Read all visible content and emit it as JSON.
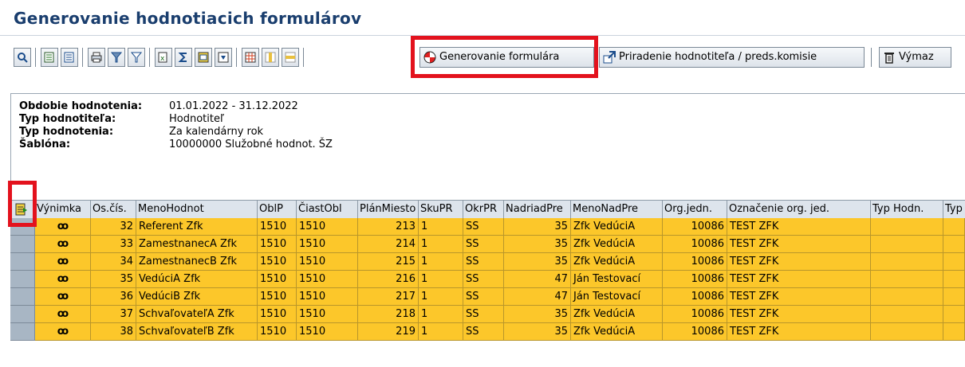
{
  "page_title": "Generovanie hodnotiacich formulárov",
  "toolbar": {
    "icons": [
      "details-icon",
      "ascending-sort-icon",
      "descending-sort-icon",
      "print-icon",
      "filter-icon",
      "filter-settings-icon",
      "export-icon",
      "totals-icon",
      "layout-icon",
      "select-layout-icon",
      "grid-icon",
      "grid-column-icon",
      "grid-row-icon"
    ],
    "generate_label": "Generovanie formulára",
    "assign_label": "Priradenie hodnotiteľa / preds.komisie",
    "delete_label": "Výmaz"
  },
  "header": {
    "period_label": "Obdobie hodnotenia:",
    "period_value": "01.01.2022 - 31.12.2022",
    "evaluator_type_label": "Typ hodnotiteľa:",
    "evaluator_type_value": "Hodnotiteľ",
    "evaluation_type_label": "Typ hodnotenia:",
    "evaluation_type_value": "Za kalendárny rok",
    "template_label": "Šablóna:",
    "template_value": "10000000 Služobné hodnot. ŠZ"
  },
  "grid": {
    "columns": [
      "Výnimka",
      "Os.čís.",
      "MenoHodnot",
      "OblP",
      "ČiastObl",
      "PlánMiesto",
      "SkuPR",
      "OkrPR",
      "NadriadPre",
      "MenoNadPre",
      "Org.jedn.",
      "Označenie org. jed.",
      "Typ Hodn.",
      "Typ"
    ],
    "rows": [
      {
        "exception": "ꝏ",
        "pernr": "32",
        "name": "Referent Zfk",
        "oblp": "1510",
        "ciastobl": "1510",
        "plan": "213",
        "sku": "1",
        "okr": "SS",
        "nadriad": "35",
        "menonad": "Zfk VedúciA",
        "org": "10086",
        "orgtext": "TEST ZFK"
      },
      {
        "exception": "ꝏ",
        "pernr": "33",
        "name": "ZamestnanecA Zfk",
        "oblp": "1510",
        "ciastobl": "1510",
        "plan": "214",
        "sku": "1",
        "okr": "SS",
        "nadriad": "35",
        "menonad": "Zfk VedúciA",
        "org": "10086",
        "orgtext": "TEST ZFK"
      },
      {
        "exception": "ꝏ",
        "pernr": "34",
        "name": "ZamestnanecB Zfk",
        "oblp": "1510",
        "ciastobl": "1510",
        "plan": "215",
        "sku": "1",
        "okr": "SS",
        "nadriad": "35",
        "menonad": "Zfk VedúciA",
        "org": "10086",
        "orgtext": "TEST ZFK"
      },
      {
        "exception": "ꝏ",
        "pernr": "35",
        "name": "VedúciA Zfk",
        "oblp": "1510",
        "ciastobl": "1510",
        "plan": "216",
        "sku": "1",
        "okr": "SS",
        "nadriad": "47",
        "menonad": "Ján Testovací",
        "org": "10086",
        "orgtext": "TEST ZFK"
      },
      {
        "exception": "ꝏ",
        "pernr": "36",
        "name": "VedúciB Zfk",
        "oblp": "1510",
        "ciastobl": "1510",
        "plan": "217",
        "sku": "1",
        "okr": "SS",
        "nadriad": "47",
        "menonad": "Ján Testovací",
        "org": "10086",
        "orgtext": "TEST ZFK"
      },
      {
        "exception": "ꝏ",
        "pernr": "37",
        "name": "SchvaľovateľA Zfk",
        "oblp": "1510",
        "ciastobl": "1510",
        "plan": "218",
        "sku": "1",
        "okr": "SS",
        "nadriad": "35",
        "menonad": "Zfk VedúciA",
        "org": "10086",
        "orgtext": "TEST ZFK"
      },
      {
        "exception": "ꝏ",
        "pernr": "38",
        "name": "SchvaľovateľB Zfk",
        "oblp": "1510",
        "ciastobl": "1510",
        "plan": "219",
        "sku": "1",
        "okr": "SS",
        "nadriad": "35",
        "menonad": "Zfk VedúciA",
        "org": "10086",
        "orgtext": "TEST ZFK"
      }
    ]
  },
  "colors": {
    "title": "#1a3e6e",
    "row_bg": "#fcc72a",
    "header_bg": "#dde4ec",
    "highlight": "#e3121d"
  }
}
